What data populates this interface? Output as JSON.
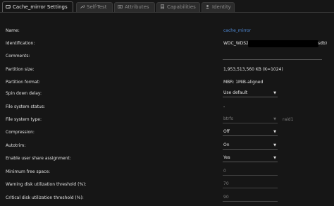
{
  "tabs": [
    {
      "label": "Cache_mirror Settings",
      "icon": "hdd-icon"
    },
    {
      "label": "Self-Test",
      "icon": "wrench-icon"
    },
    {
      "label": "Attributes",
      "icon": "list-icon"
    },
    {
      "label": "Capabilities",
      "icon": "table-icon"
    },
    {
      "label": "Identity",
      "icon": "user-icon"
    }
  ],
  "fields": {
    "name": {
      "label": "Name:",
      "value": "cache_mirror"
    },
    "identification": {
      "label": "Identification:",
      "value": "WDC_WDS2",
      "suffix": "sdb)"
    },
    "comments": {
      "label": "Comments:",
      "value": ""
    },
    "partition_size": {
      "label": "Partition size:",
      "value": "1,953,513,560 KB (K=1024)"
    },
    "partition_format": {
      "label": "Partition format:",
      "value": "MBR: 1MiB-aligned"
    },
    "spin_down": {
      "label": "Spin down delay:",
      "value": "Use default"
    },
    "fs_status": {
      "label": "File system status:",
      "value": "-"
    },
    "fs_type": {
      "label": "File system type:",
      "value": "btrfs",
      "extra": "raid1"
    },
    "compression": {
      "label": "Compression:",
      "value": "Off"
    },
    "autotrim": {
      "label": "Autotrim:",
      "value": "On"
    },
    "user_share": {
      "label": "Enable user share assignment:",
      "value": "Yes"
    },
    "min_free": {
      "label": "Minimum free space:",
      "value": "0"
    },
    "warn_threshold": {
      "label": "Warning disk utilization threshold (%):",
      "value": "70"
    },
    "crit_threshold": {
      "label": "Critical disk utilization threshold (%):",
      "value": "90"
    }
  }
}
